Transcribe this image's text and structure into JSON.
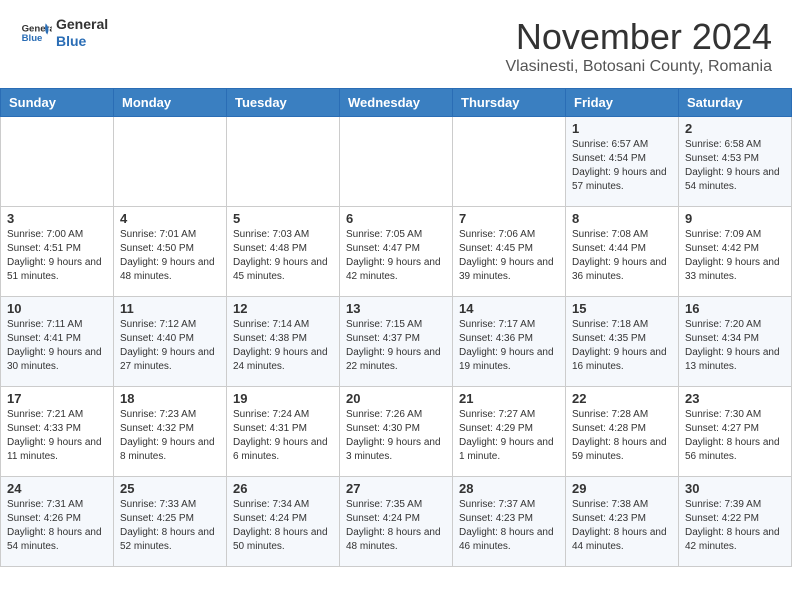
{
  "header": {
    "logo": {
      "general": "General",
      "blue": "Blue"
    },
    "title": "November 2024",
    "location": "Vlasinesti, Botosani County, Romania"
  },
  "days_of_week": [
    "Sunday",
    "Monday",
    "Tuesday",
    "Wednesday",
    "Thursday",
    "Friday",
    "Saturday"
  ],
  "weeks": [
    {
      "days": [
        {
          "num": "",
          "info": ""
        },
        {
          "num": "",
          "info": ""
        },
        {
          "num": "",
          "info": ""
        },
        {
          "num": "",
          "info": ""
        },
        {
          "num": "",
          "info": ""
        },
        {
          "num": "1",
          "info": "Sunrise: 6:57 AM\nSunset: 4:54 PM\nDaylight: 9 hours and 57 minutes."
        },
        {
          "num": "2",
          "info": "Sunrise: 6:58 AM\nSunset: 4:53 PM\nDaylight: 9 hours and 54 minutes."
        }
      ]
    },
    {
      "days": [
        {
          "num": "3",
          "info": "Sunrise: 7:00 AM\nSunset: 4:51 PM\nDaylight: 9 hours and 51 minutes."
        },
        {
          "num": "4",
          "info": "Sunrise: 7:01 AM\nSunset: 4:50 PM\nDaylight: 9 hours and 48 minutes."
        },
        {
          "num": "5",
          "info": "Sunrise: 7:03 AM\nSunset: 4:48 PM\nDaylight: 9 hours and 45 minutes."
        },
        {
          "num": "6",
          "info": "Sunrise: 7:05 AM\nSunset: 4:47 PM\nDaylight: 9 hours and 42 minutes."
        },
        {
          "num": "7",
          "info": "Sunrise: 7:06 AM\nSunset: 4:45 PM\nDaylight: 9 hours and 39 minutes."
        },
        {
          "num": "8",
          "info": "Sunrise: 7:08 AM\nSunset: 4:44 PM\nDaylight: 9 hours and 36 minutes."
        },
        {
          "num": "9",
          "info": "Sunrise: 7:09 AM\nSunset: 4:42 PM\nDaylight: 9 hours and 33 minutes."
        }
      ]
    },
    {
      "days": [
        {
          "num": "10",
          "info": "Sunrise: 7:11 AM\nSunset: 4:41 PM\nDaylight: 9 hours and 30 minutes."
        },
        {
          "num": "11",
          "info": "Sunrise: 7:12 AM\nSunset: 4:40 PM\nDaylight: 9 hours and 27 minutes."
        },
        {
          "num": "12",
          "info": "Sunrise: 7:14 AM\nSunset: 4:38 PM\nDaylight: 9 hours and 24 minutes."
        },
        {
          "num": "13",
          "info": "Sunrise: 7:15 AM\nSunset: 4:37 PM\nDaylight: 9 hours and 22 minutes."
        },
        {
          "num": "14",
          "info": "Sunrise: 7:17 AM\nSunset: 4:36 PM\nDaylight: 9 hours and 19 minutes."
        },
        {
          "num": "15",
          "info": "Sunrise: 7:18 AM\nSunset: 4:35 PM\nDaylight: 9 hours and 16 minutes."
        },
        {
          "num": "16",
          "info": "Sunrise: 7:20 AM\nSunset: 4:34 PM\nDaylight: 9 hours and 13 minutes."
        }
      ]
    },
    {
      "days": [
        {
          "num": "17",
          "info": "Sunrise: 7:21 AM\nSunset: 4:33 PM\nDaylight: 9 hours and 11 minutes."
        },
        {
          "num": "18",
          "info": "Sunrise: 7:23 AM\nSunset: 4:32 PM\nDaylight: 9 hours and 8 minutes."
        },
        {
          "num": "19",
          "info": "Sunrise: 7:24 AM\nSunset: 4:31 PM\nDaylight: 9 hours and 6 minutes."
        },
        {
          "num": "20",
          "info": "Sunrise: 7:26 AM\nSunset: 4:30 PM\nDaylight: 9 hours and 3 minutes."
        },
        {
          "num": "21",
          "info": "Sunrise: 7:27 AM\nSunset: 4:29 PM\nDaylight: 9 hours and 1 minute."
        },
        {
          "num": "22",
          "info": "Sunrise: 7:28 AM\nSunset: 4:28 PM\nDaylight: 8 hours and 59 minutes."
        },
        {
          "num": "23",
          "info": "Sunrise: 7:30 AM\nSunset: 4:27 PM\nDaylight: 8 hours and 56 minutes."
        }
      ]
    },
    {
      "days": [
        {
          "num": "24",
          "info": "Sunrise: 7:31 AM\nSunset: 4:26 PM\nDaylight: 8 hours and 54 minutes."
        },
        {
          "num": "25",
          "info": "Sunrise: 7:33 AM\nSunset: 4:25 PM\nDaylight: 8 hours and 52 minutes."
        },
        {
          "num": "26",
          "info": "Sunrise: 7:34 AM\nSunset: 4:24 PM\nDaylight: 8 hours and 50 minutes."
        },
        {
          "num": "27",
          "info": "Sunrise: 7:35 AM\nSunset: 4:24 PM\nDaylight: 8 hours and 48 minutes."
        },
        {
          "num": "28",
          "info": "Sunrise: 7:37 AM\nSunset: 4:23 PM\nDaylight: 8 hours and 46 minutes."
        },
        {
          "num": "29",
          "info": "Sunrise: 7:38 AM\nSunset: 4:23 PM\nDaylight: 8 hours and 44 minutes."
        },
        {
          "num": "30",
          "info": "Sunrise: 7:39 AM\nSunset: 4:22 PM\nDaylight: 8 hours and 42 minutes."
        }
      ]
    }
  ]
}
